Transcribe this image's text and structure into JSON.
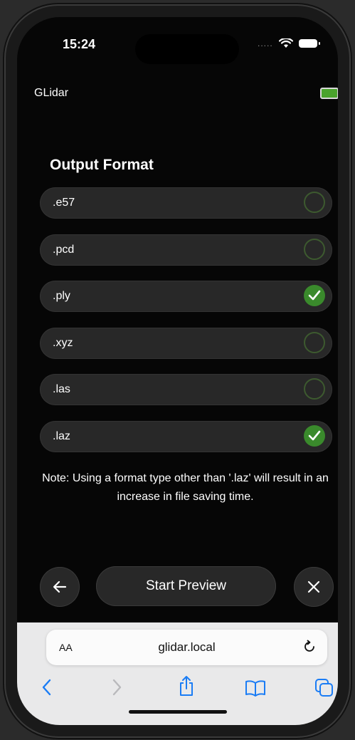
{
  "status": {
    "time": "15:24",
    "signal_dots": "....."
  },
  "app": {
    "title": "GLidar"
  },
  "output_format": {
    "title": "Output Format",
    "options": [
      {
        "label": ".e57",
        "checked": false
      },
      {
        "label": ".pcd",
        "checked": false
      },
      {
        "label": ".ply",
        "checked": true
      },
      {
        "label": ".xyz",
        "checked": false
      },
      {
        "label": ".las",
        "checked": false
      },
      {
        "label": ".laz",
        "checked": true
      }
    ],
    "note": "Note: Using a format type other than '.laz' will result in an increase in file saving time."
  },
  "actions": {
    "start_label": "Start Preview"
  },
  "browser": {
    "aa_label": "AA",
    "url": "glidar.local"
  },
  "colors": {
    "accent_green": "#3a8a2c",
    "toolbar_blue": "#1a7cf5"
  }
}
